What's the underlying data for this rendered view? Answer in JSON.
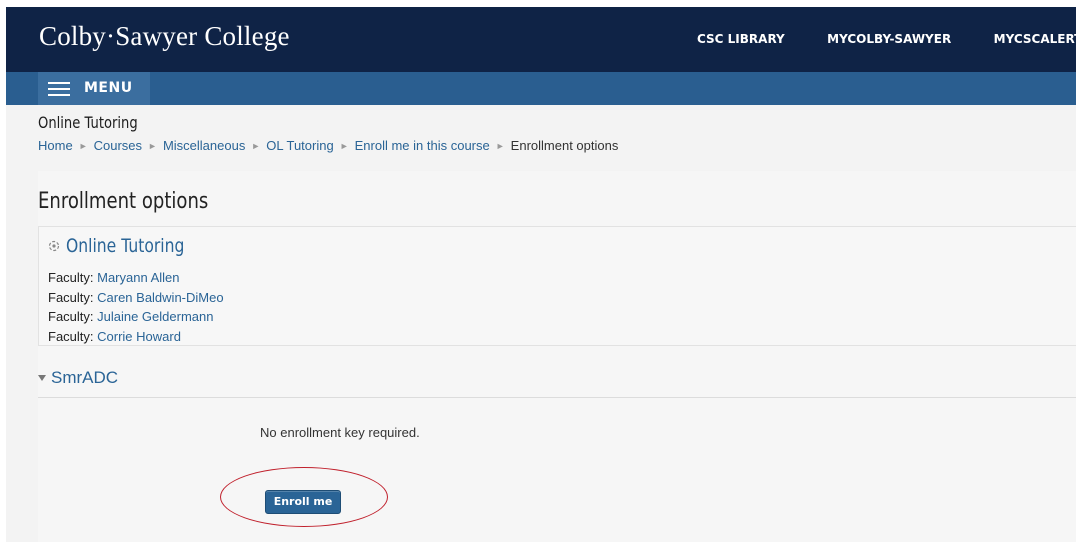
{
  "header": {
    "brand": "Colby·Sawyer College",
    "links": [
      "CSC LIBRARY",
      "MYCOLBY-SAWYER",
      "MYCSCALERT"
    ]
  },
  "menu": {
    "label": "MENU"
  },
  "page": {
    "title": "Online Tutoring",
    "breadcrumb": [
      "Home",
      "Courses",
      "Miscellaneous",
      "OL Tutoring",
      "Enroll me in this course",
      "Enrollment options"
    ]
  },
  "main": {
    "heading": "Enrollment options",
    "course": {
      "name": "Online Tutoring",
      "teachers": [
        {
          "role": "Faculty: ",
          "name": "Maryann Allen"
        },
        {
          "role": "Faculty: ",
          "name": "Caren Baldwin-DiMeo"
        },
        {
          "role": "Faculty: ",
          "name": "Julaine Geldermann"
        },
        {
          "role": "Faculty: ",
          "name": "Corrie Howard"
        }
      ]
    },
    "enrol_section": {
      "title": "SmrADC",
      "message": "No enrollment key required.",
      "button": "Enroll me"
    }
  },
  "colors": {
    "header_bg": "#0f2346",
    "menubar_bg": "#2a5e90",
    "link": "#2a6496",
    "annotation": "#c0202c"
  },
  "icons": [
    "hamburger-icon",
    "course-icon",
    "chevron-down-icon",
    "breadcrumb-separator-icon"
  ]
}
